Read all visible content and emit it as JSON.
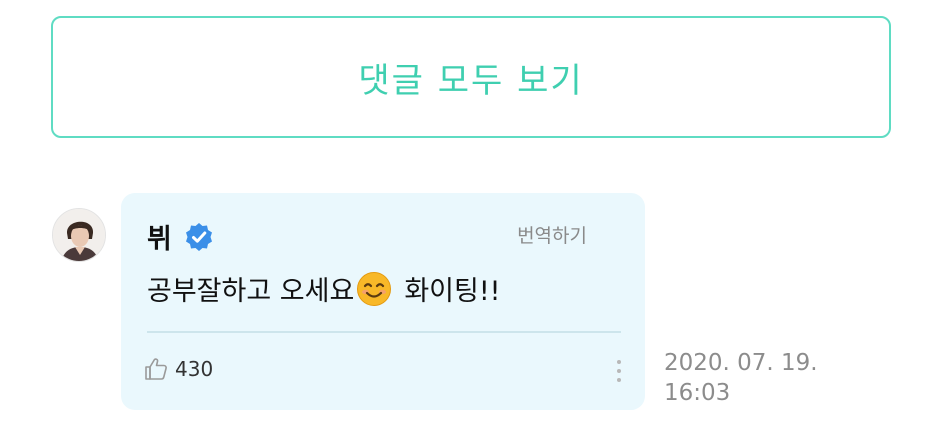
{
  "view_all_button": {
    "label": "댓글 모두 보기"
  },
  "comment": {
    "author": "뷔",
    "verified_icon": "verified-check-icon",
    "translate_label": "번역하기",
    "text_before_emoji": "공부잘하고 오세요",
    "emoji": "smiling-face-icon",
    "text_after_emoji": "화이팅!!",
    "like_icon": "thumbs-up-icon",
    "like_count": "430",
    "more_icon": "vertical-dots-icon",
    "date": "2020. 07. 19.",
    "time": "16:03"
  },
  "colors": {
    "accent": "#3fcfb0",
    "accent_border": "#5fdcc3",
    "bubble_bg": "#eaf8fd",
    "verified": "#3b8fe8"
  }
}
